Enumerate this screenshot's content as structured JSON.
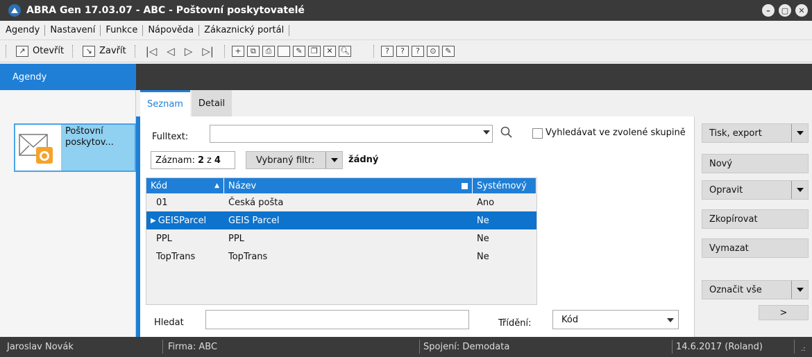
{
  "window": {
    "title": "ABRA Gen 17.03.07 - ABC - Poštovní poskytovatelé"
  },
  "menu": [
    "Agendy",
    "Nastavení",
    "Funkce",
    "Nápověda",
    "Zákaznický portál"
  ],
  "toolbar": {
    "open_label": "Otevřít",
    "close_label": "Zavřít"
  },
  "left": {
    "header": "Agendy",
    "tile_label": "Poštovní poskytov..."
  },
  "tabs": [
    "Seznam",
    "Detail"
  ],
  "filter": {
    "fulltext_label": "Fulltext:",
    "checkbox_label": "Vyhledávat ve zvolené skupině",
    "zaznam_label": "Záznam:",
    "zaznam_current": "2",
    "zaznam_of": "z",
    "zaznam_total": "4",
    "filtr_label": "Vybraný filtr:",
    "filtr_value": "žádný"
  },
  "grid": {
    "columns": [
      "Kód",
      "Název",
      "Systémový"
    ],
    "rows": [
      {
        "kod": "01",
        "nazev": "Česká pošta",
        "system": "Ano"
      },
      {
        "kod": "GEISParcel",
        "nazev": "GEIS Parcel",
        "system": "Ne"
      },
      {
        "kod": "PPL",
        "nazev": "PPL",
        "system": "Ne"
      },
      {
        "kod": "TopTrans",
        "nazev": "TopTrans",
        "system": "Ne"
      }
    ]
  },
  "bottom": {
    "hledat_label": "Hledat",
    "trideni_label": "Třídění:",
    "trideni_value": "Kód"
  },
  "actions": {
    "tisk": "Tisk, export",
    "novy": "Nový",
    "opravit": "Opravit",
    "zkopirovat": "Zkopírovat",
    "vymazat": "Vymazat",
    "oznacit": "Označit vše",
    "more": ">"
  },
  "status": {
    "user": "Jaroslav Novák",
    "firma": "Firma: ABC",
    "spojeni": "Spojení: Demodata",
    "date": "14.6.2017 (Roland)"
  },
  "colors": {
    "accent": "#1f7fd6",
    "selected_row": "#0d73cc",
    "dark_bar": "#3a3a3a",
    "tile_bg": "#90d0f0"
  }
}
